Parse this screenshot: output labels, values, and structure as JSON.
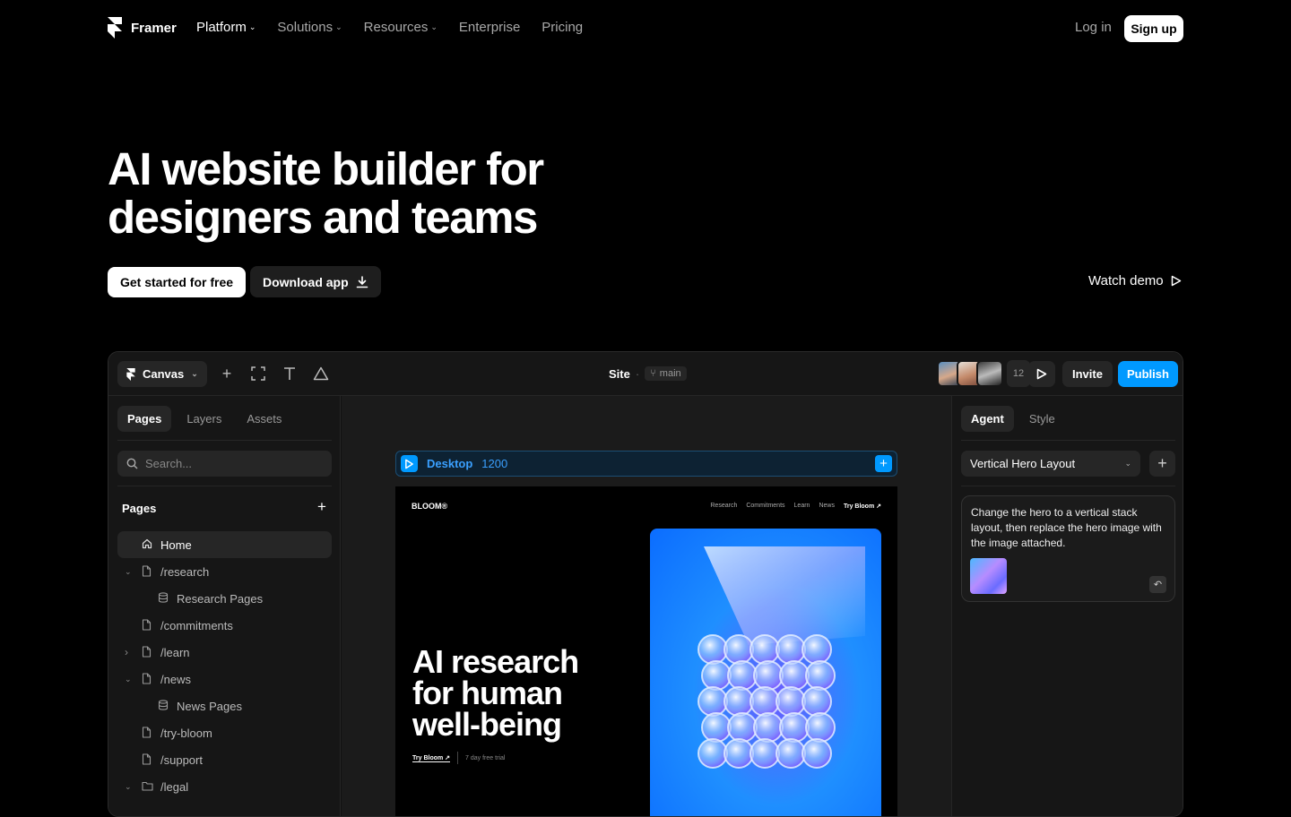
{
  "nav": {
    "brand": "Framer",
    "items": [
      {
        "label": "Platform",
        "dropdown": true,
        "active": true
      },
      {
        "label": "Solutions",
        "dropdown": true,
        "active": false
      },
      {
        "label": "Resources",
        "dropdown": true,
        "active": false
      },
      {
        "label": "Enterprise",
        "dropdown": false,
        "active": false
      },
      {
        "label": "Pricing",
        "dropdown": false,
        "active": false
      }
    ],
    "login": "Log in",
    "signup": "Sign up"
  },
  "hero": {
    "title_line1": "AI website builder for",
    "title_line2": "designers and teams",
    "cta_primary": "Get started for free",
    "cta_secondary": "Download app",
    "watch_demo": "Watch demo"
  },
  "editor": {
    "toolbar": {
      "canvas_label": "Canvas",
      "site_label": "Site",
      "branch": "main",
      "collaborator_count": "12",
      "invite": "Invite",
      "publish": "Publish"
    },
    "left_panel": {
      "tabs": [
        "Pages",
        "Layers",
        "Assets"
      ],
      "search_placeholder": "Search...",
      "pages_heading": "Pages",
      "pages": [
        {
          "label": "Home",
          "type": "home",
          "caret": "",
          "active": true
        },
        {
          "label": "/research",
          "type": "page",
          "caret": "down",
          "active": false
        },
        {
          "label": "Research Pages",
          "type": "cms",
          "caret": "",
          "active": false
        },
        {
          "label": "/commitments",
          "type": "page",
          "caret": "",
          "active": false
        },
        {
          "label": "/learn",
          "type": "page",
          "caret": "right",
          "active": false
        },
        {
          "label": "/news",
          "type": "page",
          "caret": "down",
          "active": false
        },
        {
          "label": "News Pages",
          "type": "cms",
          "caret": "",
          "active": false
        },
        {
          "label": "/try-bloom",
          "type": "page",
          "caret": "",
          "active": false
        },
        {
          "label": "/support",
          "type": "page",
          "caret": "",
          "active": false
        },
        {
          "label": "/legal",
          "type": "folder",
          "caret": "down",
          "active": false
        }
      ]
    },
    "canvas": {
      "frame_name": "Desktop",
      "frame_width": "1200",
      "preview": {
        "logo": "BLOOM®",
        "nav": [
          "Research",
          "Commitments",
          "Learn",
          "News"
        ],
        "nav_cta": "Try Bloom ↗",
        "title_lines": [
          "AI research",
          "for human",
          "well-being"
        ],
        "cta": "Try Bloom ↗",
        "trial": "7 day free trial"
      }
    },
    "right_panel": {
      "tabs": [
        "Agent",
        "Style"
      ],
      "select_value": "Vertical Hero Layout",
      "message": "Change the hero to a vertical stack layout, then replace the hero image with the image attached."
    }
  },
  "colors": {
    "background": "#000000",
    "accent": "#0099ff",
    "panel": "#161616"
  }
}
